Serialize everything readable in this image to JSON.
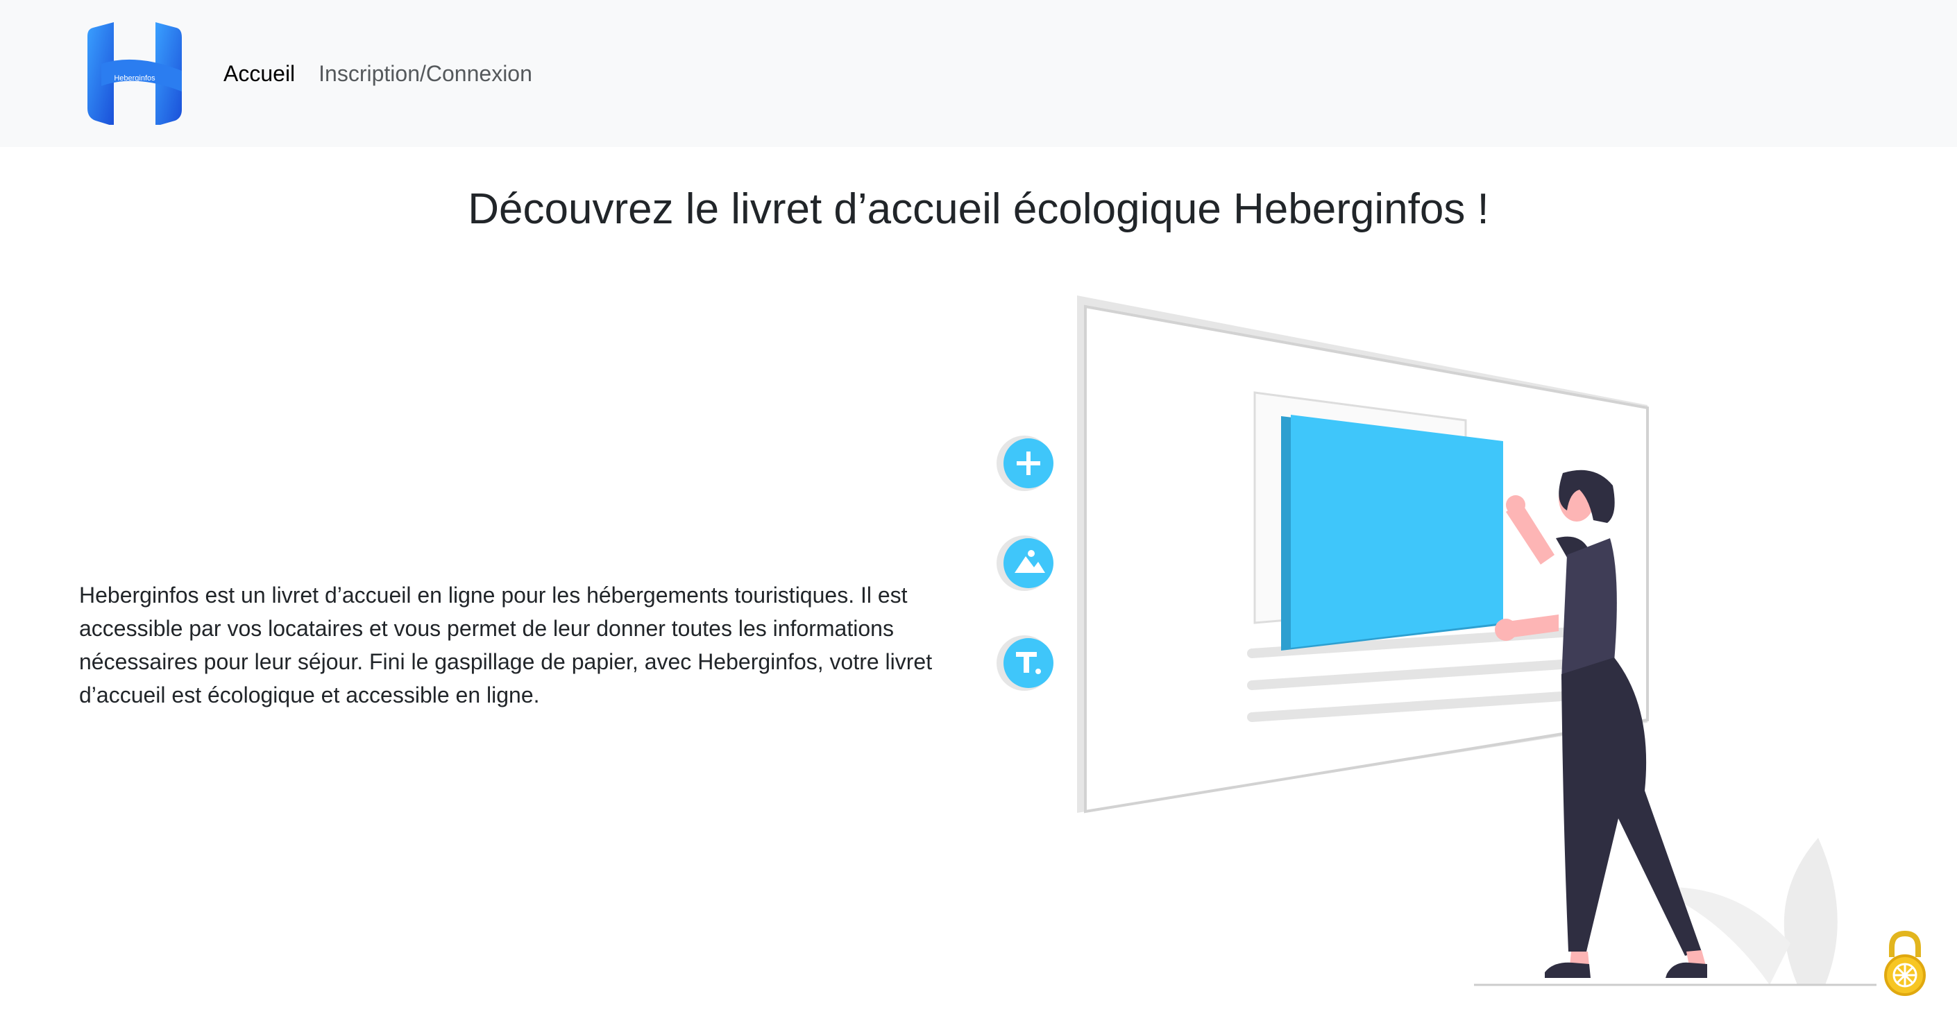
{
  "header": {
    "logo_text": "Heberginfos",
    "nav": [
      {
        "label": "Accueil",
        "active": true
      },
      {
        "label": "Inscription/Connexion",
        "active": false
      }
    ]
  },
  "main": {
    "title": "Découvrez le livret d’accueil écologique Heberginfos !",
    "description": "Heberginfos est un livret d’accueil en ligne pour les hébergements touristiques. Il est accessible par vos locataires et vous permet de leur donner toutes les informations nécessaires pour leur séjour. Fini le gaspillage de papier, avec Heberginfos, votre livret d’accueil est écologique et accessible en ligne."
  },
  "illustration": {
    "icons": [
      "plus-icon",
      "image-icon",
      "text-icon"
    ],
    "accent_color": "#3fc6fa"
  },
  "colors": {
    "navbar_bg": "#f8f9fa",
    "brand_blue": "#1e6fe8",
    "accent": "#3fc6fa",
    "text": "#212529"
  }
}
